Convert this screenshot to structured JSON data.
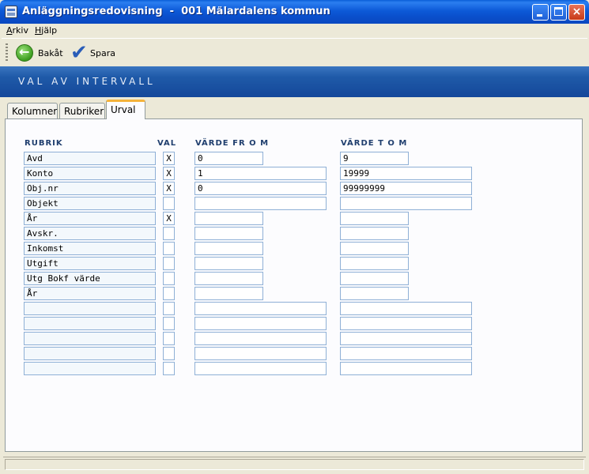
{
  "window": {
    "title": "Anläggningsredovisning  -  001 Mälardalens kommun",
    "close_glyph": "×"
  },
  "menu": {
    "arkiv": "Arkiv",
    "hjalp": "Hjälp"
  },
  "toolbar": {
    "back_label": "Bakåt",
    "save_label": "Spara",
    "check_glyph": "✔"
  },
  "banner": {
    "title": "VAL AV INTERVALL"
  },
  "tabs": [
    {
      "label": "Kolumner"
    },
    {
      "label": "Rubriker"
    },
    {
      "label": "Urval",
      "active": true
    }
  ],
  "grid": {
    "headers": {
      "rubrik": "RUBRIK",
      "val": "VAL",
      "from": "VÄRDE FR O M",
      "tom": "VÄRDE T O M"
    },
    "rows": [
      {
        "rubrik": "Avd",
        "val": "X",
        "from": "0",
        "tom": "9"
      },
      {
        "rubrik": "Konto",
        "val": "X",
        "from": "1",
        "tom": "19999"
      },
      {
        "rubrik": "Obj.nr",
        "val": "X",
        "from": "0",
        "tom": "99999999"
      },
      {
        "rubrik": "Objekt",
        "val": "",
        "from": "",
        "tom": ""
      },
      {
        "rubrik": "År",
        "val": "X",
        "from": "",
        "tom": ""
      },
      {
        "rubrik": "Avskr.",
        "val": "",
        "from": "",
        "tom": ""
      },
      {
        "rubrik": "Inkomst",
        "val": "",
        "from": "",
        "tom": ""
      },
      {
        "rubrik": "Utgift",
        "val": "",
        "from": "",
        "tom": ""
      },
      {
        "rubrik": "Utg Bokf värde",
        "val": "",
        "from": "",
        "tom": ""
      },
      {
        "rubrik": "År",
        "val": "",
        "from": "",
        "tom": ""
      },
      {
        "rubrik": "",
        "val": "",
        "from": "",
        "tom": ""
      },
      {
        "rubrik": "",
        "val": "",
        "from": "",
        "tom": ""
      },
      {
        "rubrik": "",
        "val": "",
        "from": "",
        "tom": ""
      },
      {
        "rubrik": "",
        "val": "",
        "from": "",
        "tom": ""
      },
      {
        "rubrik": "",
        "val": "",
        "from": "",
        "tom": ""
      }
    ]
  }
}
